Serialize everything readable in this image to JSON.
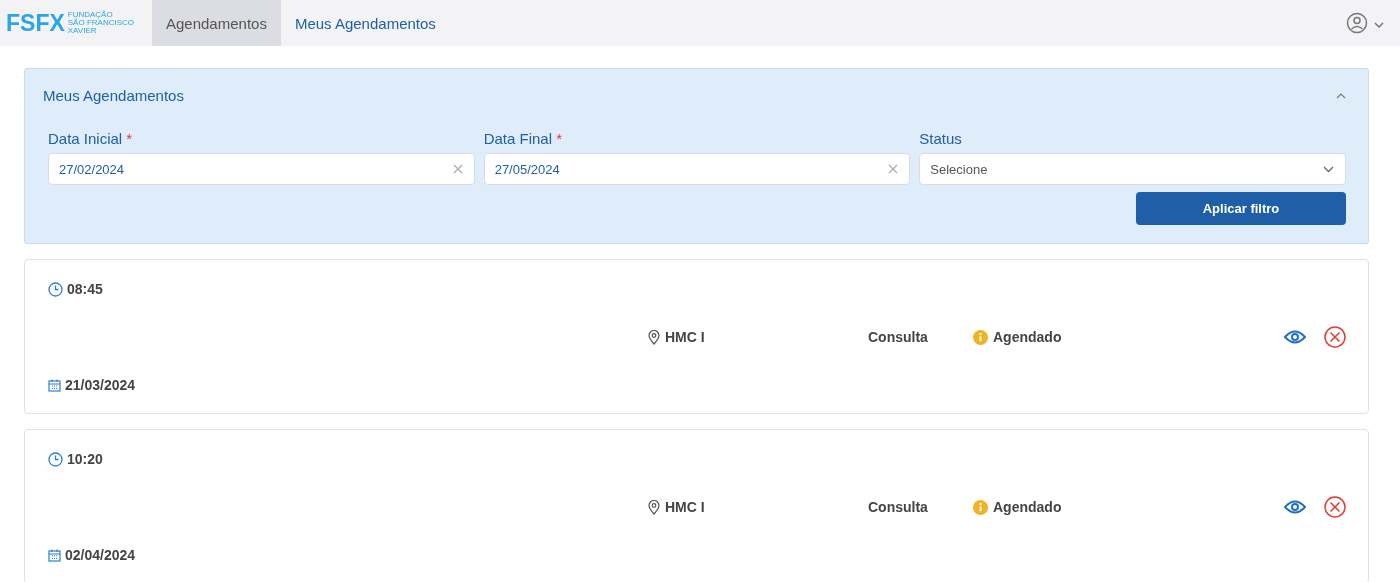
{
  "nav": {
    "logo": {
      "mark": "FSFX",
      "lines": [
        "FUNDAÇÃO",
        "SÃO FRANCISCO",
        "XAVIER"
      ]
    },
    "tabs": [
      {
        "label": "Agendamentos",
        "selected": true
      },
      {
        "label": "Meus Agendamentos",
        "selected": false
      }
    ]
  },
  "filter": {
    "title": "Meus Agendamentos",
    "expanded": true,
    "fields": [
      {
        "kind": "date",
        "label": "Data Inicial",
        "required_mark": "*",
        "value": "27/02/2024"
      },
      {
        "kind": "date",
        "label": "Data Final",
        "required_mark": "*",
        "value": "27/05/2024"
      },
      {
        "kind": "select",
        "label": "Status",
        "placeholder": "Selecione"
      }
    ],
    "apply_button": "Aplicar filtro"
  },
  "appointments": [
    {
      "time": "08:45",
      "location": "HMC I",
      "type": "Consulta",
      "status": "Agendado",
      "color": "#f0b323",
      "date": "21/03/2024"
    },
    {
      "time": "10:20",
      "location": "HMC I",
      "type": "Consulta",
      "status": "Agendado",
      "color": "#f0b323",
      "date": "02/04/2024"
    }
  ]
}
